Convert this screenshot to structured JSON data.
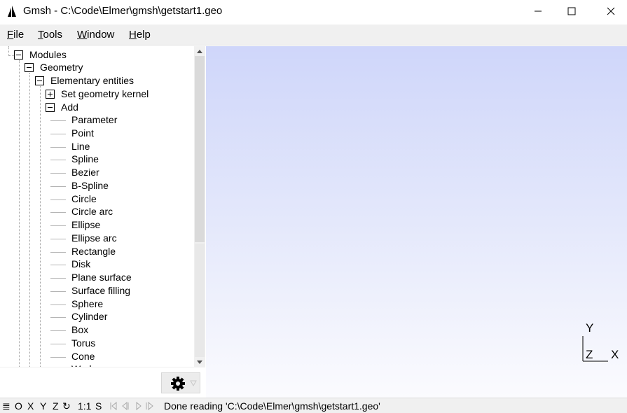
{
  "window": {
    "title": "Gmsh - C:\\Code\\Elmer\\gmsh\\getstart1.geo",
    "app_icon": "gmsh-sail-icon"
  },
  "menu": {
    "items": [
      {
        "label": "File",
        "accel": "F",
        "rest": "ile"
      },
      {
        "label": "Tools",
        "accel": "T",
        "rest": "ools"
      },
      {
        "label": "Window",
        "accel": "W",
        "rest": "indow"
      },
      {
        "label": "Help",
        "accel": "H",
        "rest": "elp"
      }
    ]
  },
  "tree": {
    "root": {
      "label": "Modules",
      "expanded": true
    },
    "geometry": {
      "label": "Geometry",
      "expanded": true
    },
    "elementary": {
      "label": "Elementary entities",
      "expanded": true
    },
    "kernel": {
      "label": "Set geometry kernel",
      "expanded": false
    },
    "add": {
      "label": "Add",
      "expanded": true
    },
    "add_items": [
      "Parameter",
      "Point",
      "Line",
      "Spline",
      "Bezier",
      "B-Spline",
      "Circle",
      "Circle arc",
      "Ellipse",
      "Ellipse arc",
      "Rectangle",
      "Disk",
      "Plane surface",
      "Surface filling",
      "Sphere",
      "Cylinder",
      "Box",
      "Torus",
      "Cone",
      "Wedge"
    ]
  },
  "viewport": {
    "axes": {
      "y": "Y",
      "z": "Z",
      "x": "X"
    },
    "gradient_top": "#cfd6fa",
    "gradient_bottom": "#fbfbfe"
  },
  "status": {
    "buttons": {
      "menu": "≣",
      "o": "O",
      "x": "X",
      "y": "Y",
      "z": "Z",
      "rotate": "↻",
      "scale": "1:1",
      "s": "S"
    },
    "message": "Done reading 'C:\\Code\\Elmer\\gmsh\\getstart1.geo'"
  }
}
